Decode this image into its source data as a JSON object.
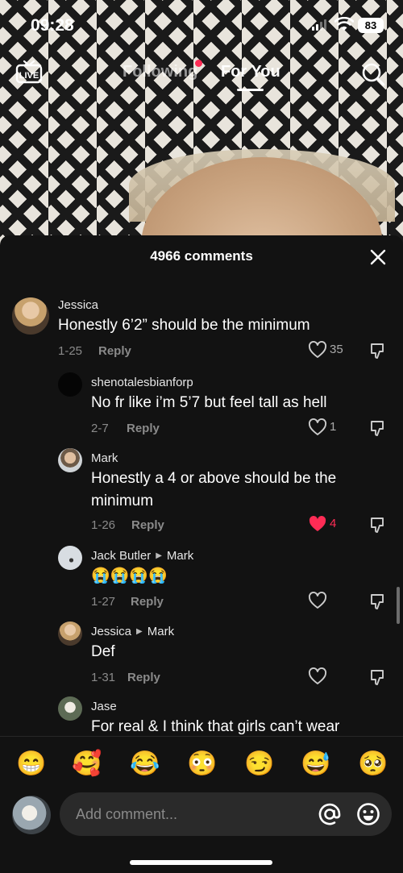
{
  "status_bar": {
    "time": "09:28",
    "battery": "83"
  },
  "top_nav": {
    "live_label": "LIVE",
    "tabs": [
      {
        "label": "Following",
        "has_dot": true,
        "active": false
      },
      {
        "label": "For You",
        "active": true
      }
    ]
  },
  "comments_header": {
    "title": "4966 comments"
  },
  "comments": [
    {
      "author": "Jessica",
      "reply_to": "",
      "text": "Honestly 6’2” should be the minimum",
      "date": "1-25",
      "reply": "Reply",
      "likes": "35",
      "liked": false
    },
    {
      "author": "shenotalesbianforp",
      "reply_to": "",
      "text": "No fr like i’m 5’7 but feel tall as hell",
      "date": "2-7",
      "reply": "Reply",
      "likes": "1",
      "liked": false
    },
    {
      "author": "Mark",
      "reply_to": "",
      "text": "Honestly a 4 or above should be the minimum",
      "date": "1-26",
      "reply": "Reply",
      "likes": "4",
      "liked": true
    },
    {
      "author": "Jack Butler",
      "reply_to": "Mark",
      "text": "😭😭😭😭",
      "date": "1-27",
      "reply": "Reply",
      "likes": "",
      "liked": false
    },
    {
      "author": "Jessica",
      "reply_to": "Mark",
      "text": "Def",
      "date": "1-31",
      "reply": "Reply",
      "likes": "",
      "liked": false
    },
    {
      "author": "Jase",
      "reply_to": "",
      "text": "For real & I think that girls can’t wear",
      "date": "",
      "reply": "",
      "likes": "",
      "liked": false
    }
  ],
  "emoji_bar": [
    "😁",
    "🥰",
    "😂",
    "😳",
    "😏",
    "😅",
    "🥺"
  ],
  "comment_input": {
    "placeholder": "Add comment..."
  },
  "colors": {
    "accent": "#fe2c55",
    "sheet_bg": "#121212",
    "input_bg": "#2a2a2a"
  }
}
